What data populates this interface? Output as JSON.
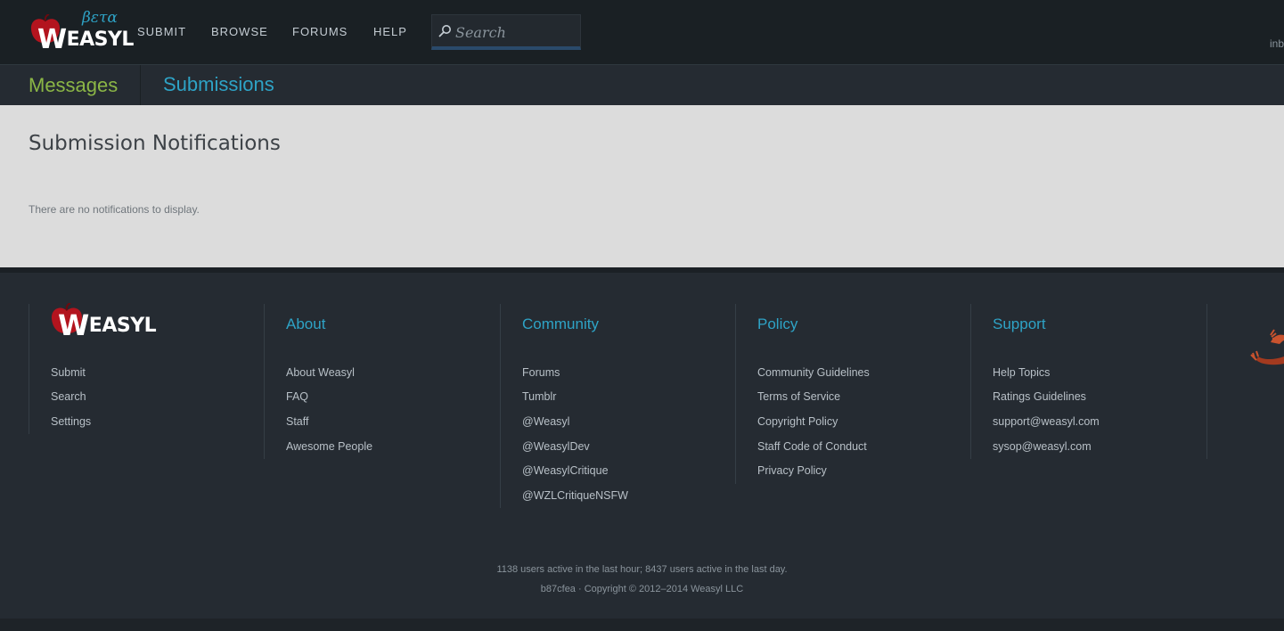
{
  "header": {
    "logo_text": "WEASYL",
    "beta_label": "βετα",
    "nav": [
      "Submit",
      "Browse",
      "Forums",
      "Help"
    ],
    "search_placeholder": "Search",
    "inbox_stub": "inb"
  },
  "tabs": {
    "messages": "Messages",
    "submissions": "Submissions"
  },
  "main": {
    "title": "Submission Notifications",
    "empty_message": "There are no notifications to display."
  },
  "footer": {
    "logo_text": "WEASYL",
    "site_links": [
      "Submit",
      "Search",
      "Settings"
    ],
    "about": {
      "heading": "About",
      "links": [
        "About Weasyl",
        "FAQ",
        "Staff",
        "Awesome People"
      ]
    },
    "community": {
      "heading": "Community",
      "links": [
        "Forums",
        "Tumblr",
        "@Weasyl",
        "@WeasylDev",
        "@WeasylCritique",
        "@WZLCritiqueNSFW"
      ]
    },
    "policy": {
      "heading": "Policy",
      "links": [
        "Community Guidelines",
        "Terms of Service",
        "Copyright Policy",
        "Staff Code of Conduct",
        "Privacy Policy"
      ]
    },
    "support": {
      "heading": "Support",
      "links": [
        "Help Topics",
        "Ratings Guidelines",
        "support@weasyl.com",
        "sysop@weasyl.com"
      ]
    },
    "stats": "1138 users active in the last hour; 8437 users active in the last day.",
    "copyright": "b87cfea · Copyright © 2012–2014 Weasyl LLC"
  },
  "colors": {
    "accent_blue": "#2ea3c6",
    "accent_green": "#8bb646",
    "logo_red": "#b3141e"
  }
}
